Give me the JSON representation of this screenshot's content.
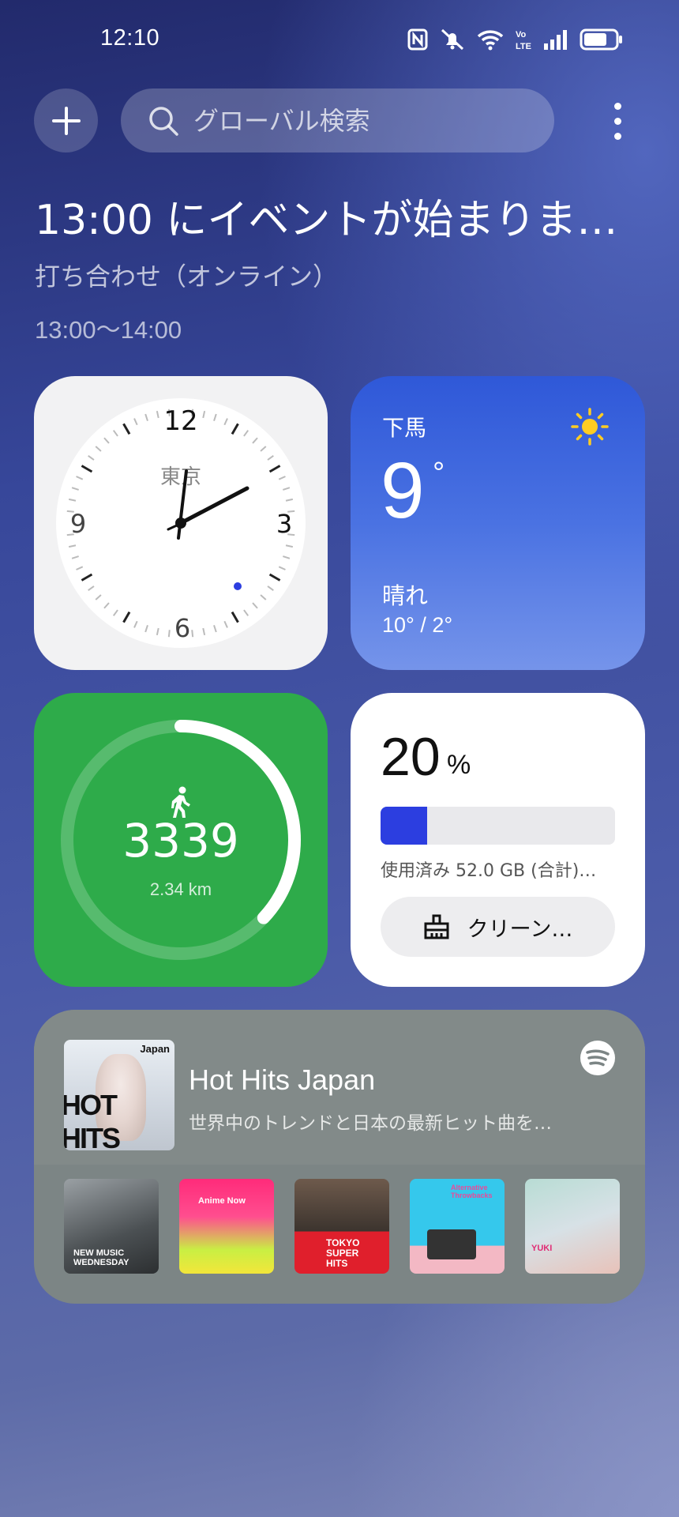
{
  "status": {
    "time": "12:10",
    "lte_label": "LTE"
  },
  "search": {
    "placeholder": "グローバル検索"
  },
  "event": {
    "title": "13:00 にイベントが始まりま…",
    "subtitle": "打ち合わせ（オンライン）",
    "time": "13:00～14:00"
  },
  "clock": {
    "city": "東京",
    "numerals": [
      "12",
      "3",
      "6",
      "9"
    ],
    "time": "12:10"
  },
  "weather": {
    "city": "下馬",
    "temp": "9",
    "degree": "°",
    "condition": "晴れ",
    "range": "10° / 2°",
    "icon": "sun-icon"
  },
  "steps": {
    "count": "3339",
    "distance": "2.34 km",
    "progress": 0.37,
    "icon": "walk-icon"
  },
  "storage": {
    "percent": "20",
    "unit": "%",
    "fill": 0.2,
    "used": "使用済み 52.0 GB (合計)…",
    "clean_label": "クリーン…"
  },
  "music": {
    "title": "Hot Hits Japan",
    "description": "世界中のトレンドと日本の最新ヒット曲を…",
    "cover": {
      "tag": "Japan",
      "title": "HOT HITS"
    },
    "thumbs": [
      {
        "label": "NEW MUSIC WEDNESDAY"
      },
      {
        "label": "Anime Now"
      },
      {
        "label": "TOKYO SUPER HITS"
      },
      {
        "label": "Alternative Throwbacks"
      },
      {
        "label": "YUKI"
      }
    ]
  },
  "colors": {
    "accent_blue": "#2c3ee0",
    "steps_green": "#2eab4a",
    "weather_blue": "#2f58d8"
  }
}
